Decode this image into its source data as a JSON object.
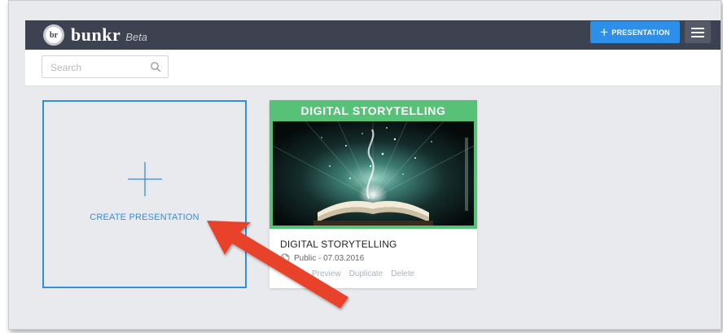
{
  "header": {
    "logo_badge": "br",
    "logo_text": "bunkr",
    "logo_beta": "Beta",
    "new_presentation_label": "PRESENTATION",
    "menu_icon": "hamburger-icon"
  },
  "search": {
    "placeholder": "Search",
    "value": "",
    "icon": "search-icon"
  },
  "create_card": {
    "label": "CREATE PRESENTATION",
    "icon": "plus-icon"
  },
  "presentation": {
    "header_title": "DIGITAL STORYTELLING",
    "name": "DIGITAL STORYTELLING",
    "visibility_icon": "globe-icon",
    "meta": "Public - 07.03.2016",
    "actions": [
      "Preview",
      "Duplicate",
      "Delete"
    ]
  },
  "colors": {
    "topbar": "#3d4250",
    "accent_blue": "#2e8fe8",
    "card_green": "#58c178",
    "annotation_arrow": "#e8432c"
  }
}
